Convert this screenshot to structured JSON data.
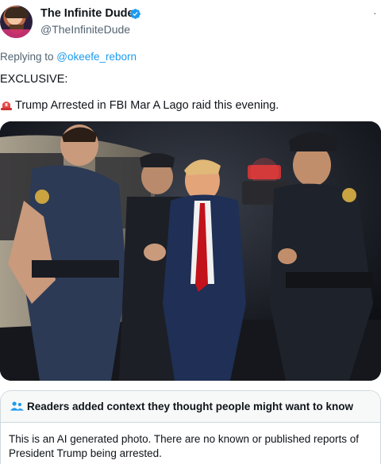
{
  "author": {
    "display_name": "The Infinite Dude",
    "handle": "@TheInfiniteDude",
    "verified_icon": "verified-badge-icon",
    "more_icon": "more-options-icon"
  },
  "reply": {
    "prefix": "Replying to ",
    "target": "@okeefe_reborn"
  },
  "tweet": {
    "line1": "EXCLUSIVE:",
    "siren_icon": "police-siren-emoji",
    "line2": "Trump Arrested in FBI Mar A Lago raid this evening."
  },
  "media": {
    "icon": "photo"
  },
  "community_note": {
    "icon": "people-icon",
    "title": "Readers added context they thought people might want to know",
    "body": "This is an AI generated photo. There are no known or published reports of President Trump being arrested."
  },
  "colors": {
    "link": "#1d9bf0",
    "muted": "#536471",
    "text": "#0f1419",
    "border": "#cfd9de"
  }
}
